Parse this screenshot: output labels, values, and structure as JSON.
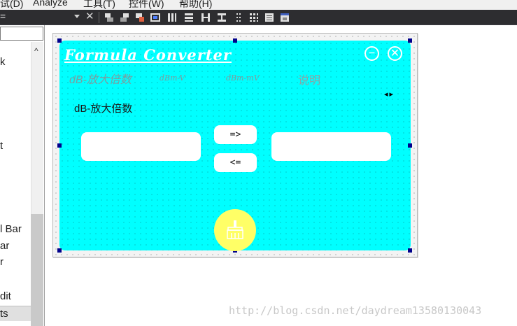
{
  "menubar": {
    "items": [
      "试(D)",
      "Analyze",
      "工具(T)",
      "控件(W)",
      "帮助(H)"
    ]
  },
  "toolbar": {
    "combo_text": "=",
    "close_glyph": "✕"
  },
  "left_panel": {
    "items": [
      "k",
      "t",
      "l Bar",
      "ar",
      "r",
      "dit"
    ],
    "scroll_up_glyph": "^",
    "bottom_tab": "ts"
  },
  "form": {
    "title": "Formula Converter",
    "minimize_glyph": "−",
    "close_glyph": "✕",
    "tabs": [
      "dB-放大倍数",
      "dBm-V",
      "dBm-mV",
      "说明"
    ],
    "tab_arrows": "◂▸",
    "section_label": "dB-放大倍数",
    "convert_right_label": "=>",
    "convert_left_label": "<=",
    "colors": {
      "background": "#00ffff",
      "action_button": "#ffff66"
    }
  },
  "watermark": "http://blog.csdn.net/daydream13580130043"
}
